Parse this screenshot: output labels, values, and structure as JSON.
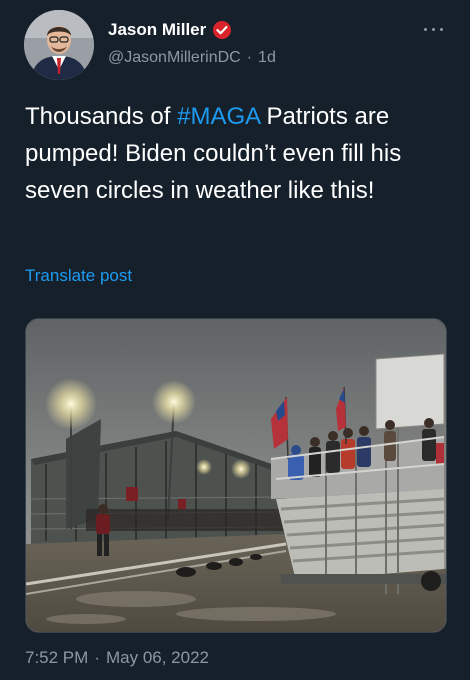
{
  "tweet": {
    "author": {
      "display_name": "Jason Miller",
      "handle": "@JasonMillerinDC",
      "relative_time": "1d",
      "separator": "·",
      "verified_icon": "verified-badge-icon",
      "verified_color": "#d8232a"
    },
    "text": {
      "before_hashtag": "Thousands of ",
      "hashtag": "#MAGA",
      "after_hashtag": " Patriots are pumped! Biden couldn’t even fill his seven circles in weather like this!"
    },
    "translate_label": "Translate post",
    "timestamp": {
      "time": "7:52 PM",
      "separator": "·",
      "date": "May 06, 2022"
    },
    "more_icon": "more-options-icon"
  },
  "colors": {
    "background": "#15202b",
    "text": "#ffffff",
    "secondary": "#8b98a5",
    "link": "#1d9bf0"
  }
}
